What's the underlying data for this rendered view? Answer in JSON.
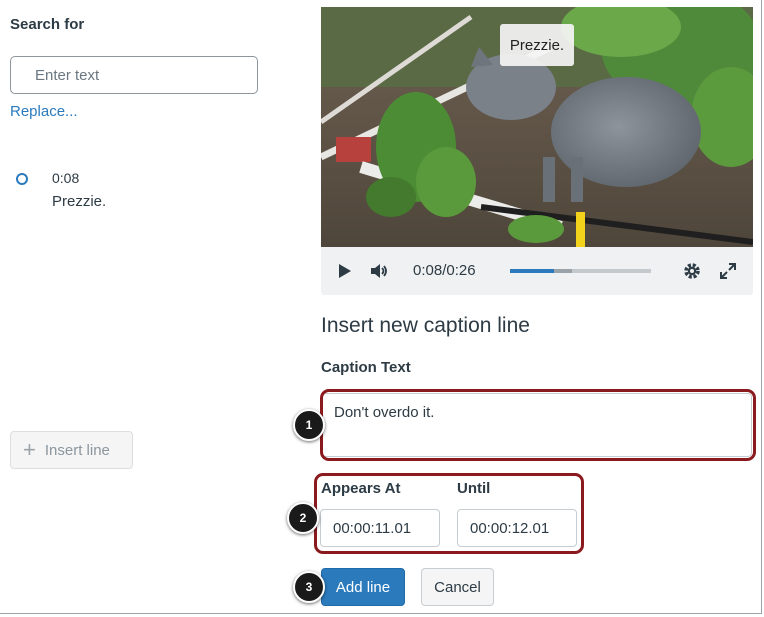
{
  "search": {
    "title": "Search for",
    "placeholder": "Enter text",
    "replace_label": "Replace..."
  },
  "cues": [
    {
      "time": "0:08",
      "text": "Prezzie."
    }
  ],
  "insert_line_label": "Insert line",
  "video": {
    "caption_overlay": "Prezzie.",
    "time_display": "0:08/0:26",
    "progress": 0.31,
    "buffered": 0.44,
    "icons": [
      "play-icon",
      "volume-icon",
      "gear-icon",
      "fullscreen-icon"
    ]
  },
  "form": {
    "heading": "Insert new caption line",
    "caption_label": "Caption Text",
    "caption_value": "Don't overdo it.",
    "appears_label": "Appears At",
    "appears_value": "00:00:11.01",
    "until_label": "Until",
    "until_value": "00:00:12.01",
    "add_label": "Add line",
    "cancel_label": "Cancel"
  },
  "steps": [
    "1",
    "2",
    "3"
  ],
  "colors": {
    "accent": "#2b7abc",
    "highlight": "#8b1a1e",
    "text": "#2d3b45"
  }
}
